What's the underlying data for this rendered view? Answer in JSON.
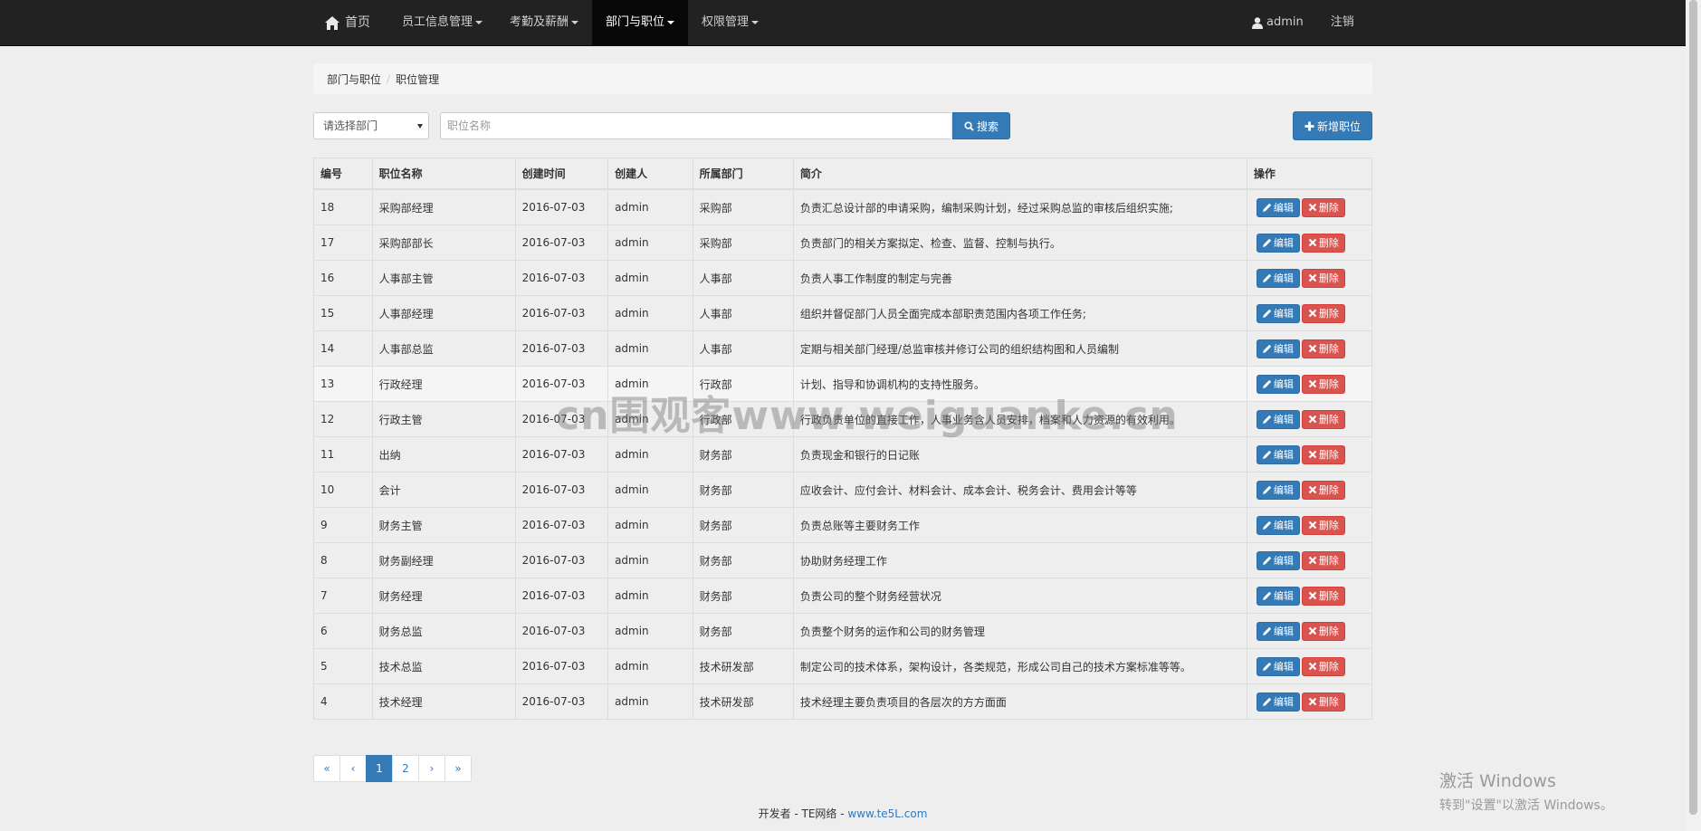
{
  "nav": {
    "home": "首页",
    "menus": [
      "员工信息管理",
      "考勤及薪酬",
      "部门与职位",
      "权限管理"
    ],
    "active_index": 2,
    "user": "admin",
    "logout": "注销"
  },
  "breadcrumb": {
    "parent": "部门与职位",
    "separator": "/",
    "current": "职位管理"
  },
  "toolbar": {
    "dept_select_value": "请选择部门",
    "search_placeholder": "职位名称",
    "search_label": "搜索",
    "add_label": "新增职位"
  },
  "table": {
    "headers": [
      "编号",
      "职位名称",
      "创建时间",
      "创建人",
      "所属部门",
      "简介",
      "操作"
    ],
    "edit_label": "编辑",
    "delete_label": "删除",
    "rows": [
      [
        "18",
        "采购部经理",
        "2016-07-03",
        "admin",
        "采购部",
        "负责汇总设计部的申请采购，编制采购计划，经过采购总监的审核后组织实施;"
      ],
      [
        "17",
        "采购部部长",
        "2016-07-03",
        "admin",
        "采购部",
        "负责部门的相关方案拟定、检查、监督、控制与执行。"
      ],
      [
        "16",
        "人事部主管",
        "2016-07-03",
        "admin",
        "人事部",
        "负责人事工作制度的制定与完善"
      ],
      [
        "15",
        "人事部经理",
        "2016-07-03",
        "admin",
        "人事部",
        "组织并督促部门人员全面完成本部职责范围内各项工作任务;"
      ],
      [
        "14",
        "人事部总监",
        "2016-07-03",
        "admin",
        "人事部",
        "定期与相关部门经理/总监审核并修订公司的组织结构图和人员编制"
      ],
      [
        "13",
        "行政经理",
        "2016-07-03",
        "admin",
        "行政部",
        "计划、指导和协调机构的支持性服务。"
      ],
      [
        "12",
        "行政主管",
        "2016-07-03",
        "admin",
        "行政部",
        "行政负责单位的直接工作，人事业务含人员安排，档案和人力资源的有效利用。"
      ],
      [
        "11",
        "出纳",
        "2016-07-03",
        "admin",
        "财务部",
        "负责现金和银行的日记账"
      ],
      [
        "10",
        "会计",
        "2016-07-03",
        "admin",
        "财务部",
        "应收会计、应付会计、材料会计、成本会计、税务会计、费用会计等等"
      ],
      [
        "9",
        "财务主管",
        "2016-07-03",
        "admin",
        "财务部",
        "负责总账等主要财务工作"
      ],
      [
        "8",
        "财务副经理",
        "2016-07-03",
        "admin",
        "财务部",
        "协助财务经理工作"
      ],
      [
        "7",
        "财务经理",
        "2016-07-03",
        "admin",
        "财务部",
        "负责公司的整个财务经营状况"
      ],
      [
        "6",
        "财务总监",
        "2016-07-03",
        "admin",
        "财务部",
        "负责整个财务的运作和公司的财务管理"
      ],
      [
        "5",
        "技术总监",
        "2016-07-03",
        "admin",
        "技术研发部",
        "制定公司的技术体系，架构设计，各类规范，形成公司自己的技术方案标准等等。"
      ],
      [
        "4",
        "技术经理",
        "2016-07-03",
        "admin",
        "技术研发部",
        "技术经理主要负责项目的各层次的方方面面"
      ]
    ]
  },
  "pagination": {
    "items": [
      "«",
      "‹",
      "1",
      "2",
      "›",
      "»"
    ],
    "active": "1"
  },
  "footer": {
    "prefix": "开发者 - TE网络 - ",
    "link": "www.te5L.com"
  },
  "watermark": "cn围观客www.weiguanke.cn",
  "windows_activation": {
    "title": "激活 Windows",
    "subtitle": "转到\"设置\"以激活 Windows。"
  },
  "colors": {
    "primary": "#337ab7",
    "danger": "#d9534f",
    "navbar": "#222222"
  }
}
